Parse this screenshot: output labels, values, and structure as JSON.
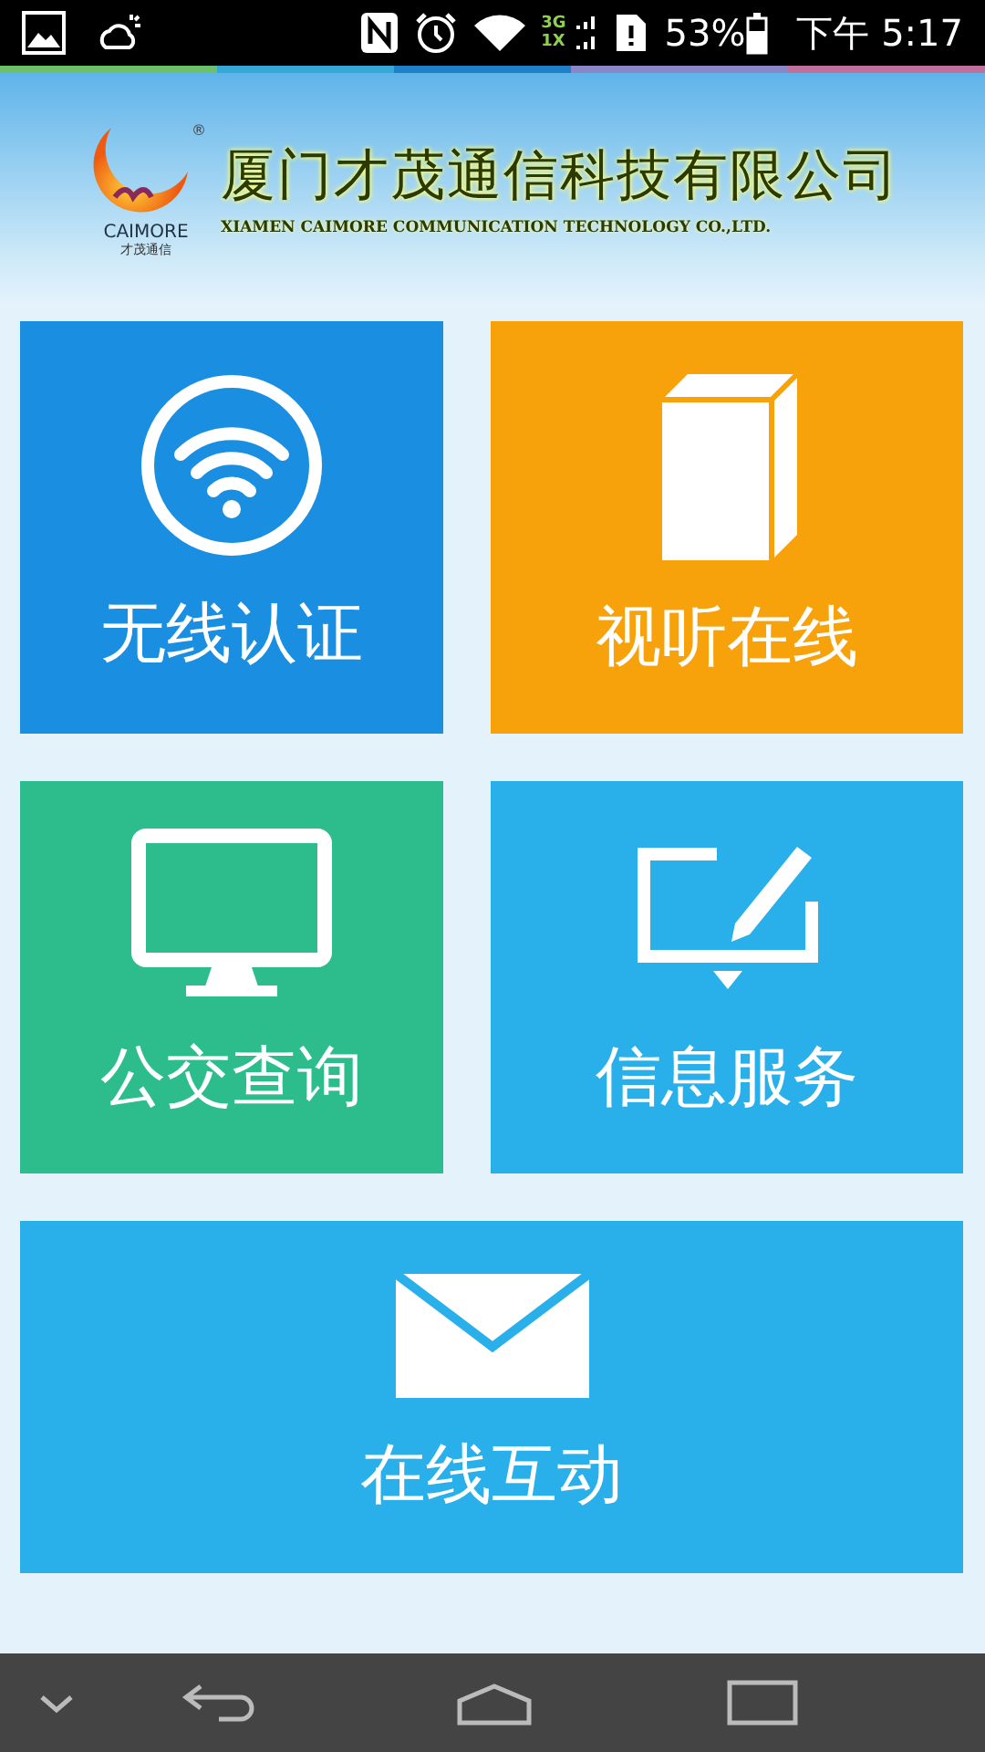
{
  "status_bar": {
    "network_3g": "3G",
    "network_1x": "1X",
    "battery": "53%",
    "time": "下午 5:17"
  },
  "header": {
    "registered": "®",
    "logo_text": "CAIMORE",
    "logo_subtext": "才茂通信",
    "company_name": "厦门才茂通信科技有限公司",
    "company_name_en": "XIAMEN CAIMORE COMMUNICATION TECHNOLOGY CO.,LTD."
  },
  "tiles": [
    {
      "label": "无线认证",
      "kind": "wifi",
      "color": "#1a8ee0"
    },
    {
      "label": "视听在线",
      "kind": "book",
      "color": "#f7a20b"
    },
    {
      "label": "公交查询",
      "kind": "monitor",
      "color": "#2dbd8c"
    },
    {
      "label": "信息服务",
      "kind": "tablet",
      "color": "#29b0ea"
    },
    {
      "label": "在线互动",
      "kind": "envelope",
      "color": "#29b0ea"
    }
  ]
}
